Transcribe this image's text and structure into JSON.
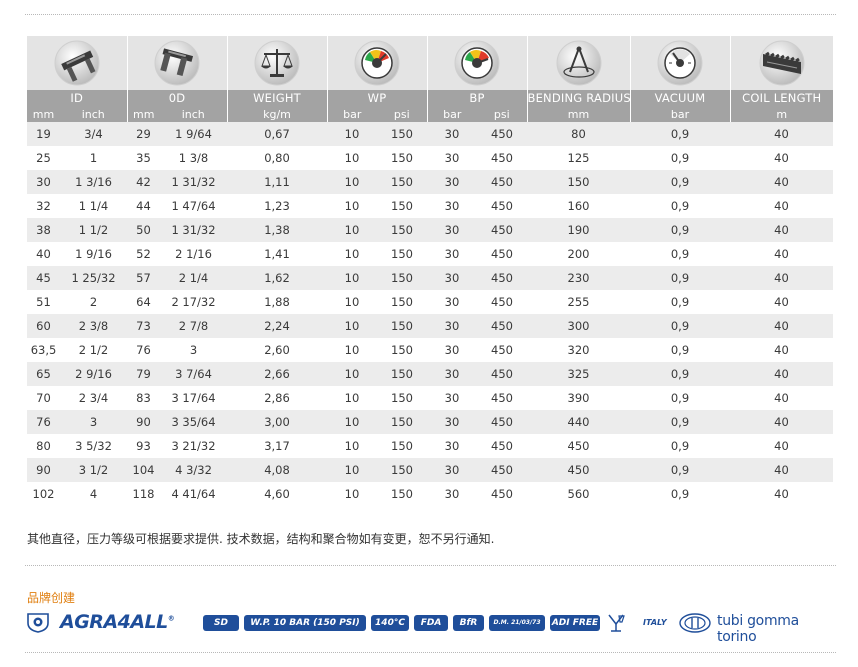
{
  "table": {
    "headers": {
      "id": "ID",
      "od": "0D",
      "weight": "WEIGHT",
      "wp": "WP",
      "bp": "BP",
      "bending_radius": "BENDING RADIUS",
      "vacuum": "VACUUM",
      "coil_length": "COIL LENGTH"
    },
    "icons": {
      "id": "caliper-inner-icon",
      "od": "caliper-outer-icon",
      "weight": "scale-balance-icon",
      "wp": "pressure-gauge-icon",
      "bp": "pressure-gauge-icon",
      "bending_radius": "compass-radius-icon",
      "vacuum": "vacuum-gauge-icon",
      "coil_length": "hose-coil-icon"
    },
    "units": [
      "mm",
      "inch",
      "mm",
      "inch",
      "kg/m",
      "bar",
      "psi",
      "bar",
      "psi",
      "mm",
      "bar",
      "m"
    ],
    "rows": [
      [
        "19",
        "3/4",
        "29",
        "1 9/64",
        "0,67",
        "10",
        "150",
        "30",
        "450",
        "80",
        "0,9",
        "40"
      ],
      [
        "25",
        "1",
        "35",
        "1 3/8",
        "0,80",
        "10",
        "150",
        "30",
        "450",
        "125",
        "0,9",
        "40"
      ],
      [
        "30",
        "1 3/16",
        "42",
        "1 31/32",
        "1,11",
        "10",
        "150",
        "30",
        "450",
        "150",
        "0,9",
        "40"
      ],
      [
        "32",
        "1 1/4",
        "44",
        "1 47/64",
        "1,23",
        "10",
        "150",
        "30",
        "450",
        "160",
        "0,9",
        "40"
      ],
      [
        "38",
        "1 1/2",
        "50",
        "1 31/32",
        "1,38",
        "10",
        "150",
        "30",
        "450",
        "190",
        "0,9",
        "40"
      ],
      [
        "40",
        "1 9/16",
        "52",
        "2 1/16",
        "1,41",
        "10",
        "150",
        "30",
        "450",
        "200",
        "0,9",
        "40"
      ],
      [
        "45",
        "1 25/32",
        "57",
        "2 1/4",
        "1,62",
        "10",
        "150",
        "30",
        "450",
        "230",
        "0,9",
        "40"
      ],
      [
        "51",
        "2",
        "64",
        "2 17/32",
        "1,88",
        "10",
        "150",
        "30",
        "450",
        "255",
        "0,9",
        "40"
      ],
      [
        "60",
        "2 3/8",
        "73",
        "2 7/8",
        "2,24",
        "10",
        "150",
        "30",
        "450",
        "300",
        "0,9",
        "40"
      ],
      [
        "63,5",
        "2 1/2",
        "76",
        "3",
        "2,60",
        "10",
        "150",
        "30",
        "450",
        "320",
        "0,9",
        "40"
      ],
      [
        "65",
        "2 9/16",
        "79",
        "3 7/64",
        "2,66",
        "10",
        "150",
        "30",
        "450",
        "325",
        "0,9",
        "40"
      ],
      [
        "70",
        "2 3/4",
        "83",
        "3 17/64",
        "2,86",
        "10",
        "150",
        "30",
        "450",
        "390",
        "0,9",
        "40"
      ],
      [
        "76",
        "3",
        "90",
        "3 35/64",
        "3,00",
        "10",
        "150",
        "30",
        "450",
        "440",
        "0,9",
        "40"
      ],
      [
        "80",
        "3 5/32",
        "93",
        "3 21/32",
        "3,17",
        "10",
        "150",
        "30",
        "450",
        "450",
        "0,9",
        "40"
      ],
      [
        "90",
        "3 1/2",
        "104",
        "4 3/32",
        "4,08",
        "10",
        "150",
        "30",
        "450",
        "450",
        "0,9",
        "40"
      ],
      [
        "102",
        "4",
        "118",
        "4 41/64",
        "4,60",
        "10",
        "150",
        "30",
        "450",
        "560",
        "0,9",
        "40"
      ]
    ]
  },
  "note": "其他直径，压力等级可根据要求提供. 技术数据，结构和聚合物如有变更，恕不另行通知.",
  "brand": {
    "label": "品牌创建",
    "logo_text": "AGRA4ALL",
    "logo_registered": "®",
    "badges": [
      "SD",
      "W.P. 10 BAR (150 PSI)",
      "140°C",
      "FDA",
      "BfR",
      "D.M. 21/03/73",
      "ADI FREE"
    ],
    "italy": "ITALY",
    "maker": "tubi gomma torino"
  },
  "colors": {
    "header_bg": "#a3a3a3",
    "icon_bg": "#e4e4e4",
    "stripe": "#ececec",
    "brand_blue": "#1f4e9a",
    "label_orange": "#e07f10"
  }
}
